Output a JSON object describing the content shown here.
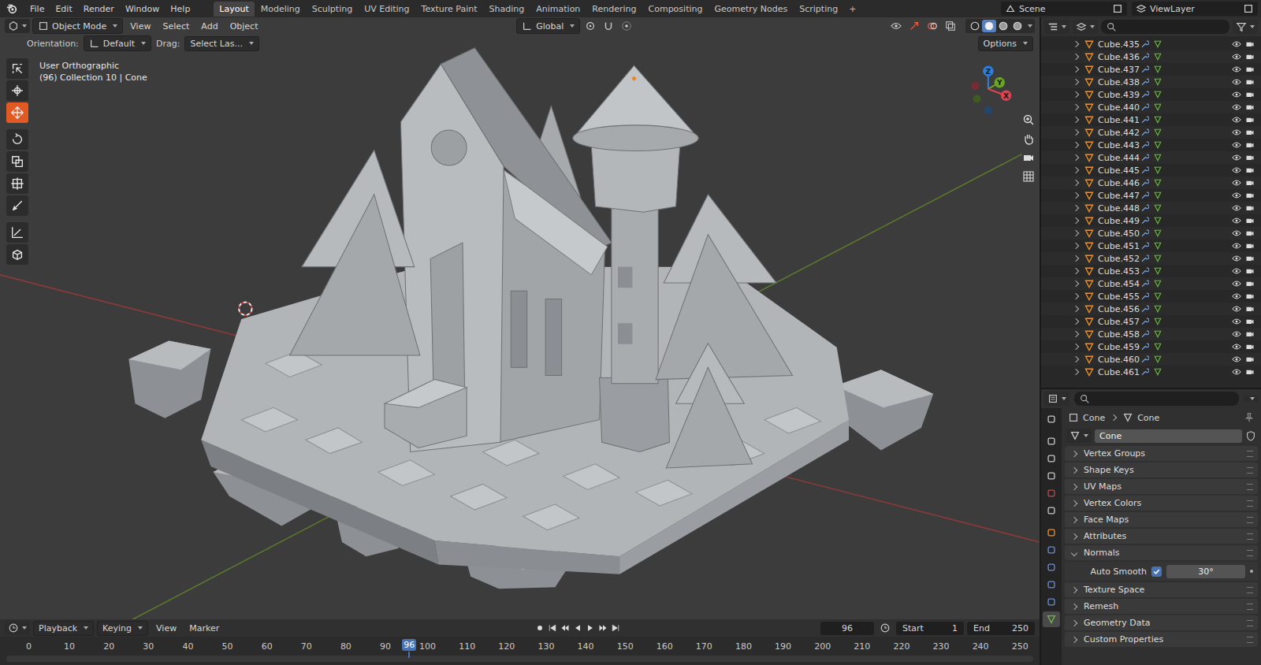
{
  "menubar": {
    "menus": [
      "File",
      "Edit",
      "Render",
      "Window",
      "Help"
    ]
  },
  "workspaces": [
    {
      "label": "Layout",
      "selected": true
    },
    {
      "label": "Modeling",
      "selected": false
    },
    {
      "label": "Sculpting",
      "selected": false
    },
    {
      "label": "UV Editing",
      "selected": false
    },
    {
      "label": "Texture Paint",
      "selected": false
    },
    {
      "label": "Shading",
      "selected": false
    },
    {
      "label": "Animation",
      "selected": false
    },
    {
      "label": "Rendering",
      "selected": false
    },
    {
      "label": "Compositing",
      "selected": false
    },
    {
      "label": "Geometry Nodes",
      "selected": false
    },
    {
      "label": "Scripting",
      "selected": false
    }
  ],
  "add_workspace": "+",
  "scene": {
    "label": "Scene"
  },
  "view_layer": {
    "label": "ViewLayer"
  },
  "viewport": {
    "mode": "Object Mode",
    "menus": [
      "View",
      "Select",
      "Add",
      "Object"
    ],
    "orientation": "Global",
    "shading": [
      {
        "selected": false
      },
      {
        "selected": true
      },
      {
        "selected": false
      },
      {
        "selected": false
      }
    ],
    "tool_settings": {
      "orientation_label": "Orientation:",
      "orientation": "Default",
      "drag_label": "Drag:",
      "drag": "Select Las...",
      "options": "Options"
    },
    "view_name": "User Orthographic",
    "collection_info": "(96) Collection 10 | Cone",
    "tools": [
      {
        "selected": false
      },
      {
        "selected": false
      },
      {
        "selected": true
      },
      {
        "selected": false
      },
      {
        "selected": false
      },
      {
        "selected": false
      },
      {
        "selected": false
      },
      {
        "selected": false
      },
      {
        "selected": false
      }
    ],
    "gizmo_axes": [
      {
        "label": "Z",
        "color": "#2f7fd8"
      },
      {
        "label": "Y",
        "color": "#6aa52a"
      },
      {
        "label": "X",
        "color": "#e0414f"
      }
    ]
  },
  "outliner": {
    "items": [
      {
        "name": "Cube.435",
        "expanded": false,
        "visible": true
      },
      {
        "name": "Cube.436",
        "expanded": false,
        "visible": true
      },
      {
        "name": "Cube.437",
        "expanded": false,
        "visible": true
      },
      {
        "name": "Cube.438",
        "expanded": false,
        "visible": true
      },
      {
        "name": "Cube.439",
        "expanded": false,
        "visible": true
      },
      {
        "name": "Cube.440",
        "expanded": false,
        "visible": true
      },
      {
        "name": "Cube.441",
        "expanded": false,
        "visible": true
      },
      {
        "name": "Cube.442",
        "expanded": false,
        "visible": true
      },
      {
        "name": "Cube.443",
        "expanded": false,
        "visible": true
      },
      {
        "name": "Cube.444",
        "expanded": false,
        "visible": true
      },
      {
        "name": "Cube.445",
        "expanded": false,
        "visible": true
      },
      {
        "name": "Cube.446",
        "expanded": false,
        "visible": true
      },
      {
        "name": "Cube.447",
        "expanded": false,
        "visible": true
      },
      {
        "name": "Cube.448",
        "expanded": false,
        "visible": true
      },
      {
        "name": "Cube.449",
        "expanded": false,
        "visible": true
      },
      {
        "name": "Cube.450",
        "expanded": false,
        "visible": true
      },
      {
        "name": "Cube.451",
        "expanded": false,
        "visible": true
      },
      {
        "name": "Cube.452",
        "expanded": false,
        "visible": true
      },
      {
        "name": "Cube.453",
        "expanded": false,
        "visible": true
      },
      {
        "name": "Cube.454",
        "expanded": false,
        "visible": true
      },
      {
        "name": "Cube.455",
        "expanded": false,
        "visible": true
      },
      {
        "name": "Cube.456",
        "expanded": false,
        "visible": true
      },
      {
        "name": "Cube.457",
        "expanded": false,
        "visible": true
      },
      {
        "name": "Cube.458",
        "expanded": false,
        "visible": true
      },
      {
        "name": "Cube.459",
        "expanded": false,
        "visible": true
      },
      {
        "name": "Cube.460",
        "expanded": false,
        "visible": true
      },
      {
        "name": "Cube.461",
        "expanded": false,
        "visible": true
      }
    ]
  },
  "properties": {
    "tabs": [
      {
        "selected": false
      },
      {
        "selected": false
      },
      {
        "selected": false
      },
      {
        "selected": false
      },
      {
        "selected": false
      },
      {
        "selected": false
      },
      {
        "selected": false
      },
      {
        "selected": false
      },
      {
        "selected": false
      },
      {
        "selected": false
      },
      {
        "selected": false
      },
      {
        "selected": true
      }
    ],
    "breadcrumb": [
      "Cone",
      "Cone"
    ],
    "data_name": "Cone",
    "panels": [
      {
        "label": "Vertex Groups",
        "expanded": false
      },
      {
        "label": "Shape Keys",
        "expanded": false
      },
      {
        "label": "UV Maps",
        "expanded": false
      },
      {
        "label": "Vertex Colors",
        "expanded": false
      },
      {
        "label": "Face Maps",
        "expanded": false
      },
      {
        "label": "Attributes",
        "expanded": false
      },
      {
        "label": "Normals",
        "expanded": true
      },
      {
        "label": "Texture Space",
        "expanded": false
      },
      {
        "label": "Remesh",
        "expanded": false
      },
      {
        "label": "Geometry Data",
        "expanded": false
      },
      {
        "label": "Custom Properties",
        "expanded": false
      }
    ],
    "normals": {
      "auto_smooth_label": "Auto Smooth",
      "auto_smooth": true,
      "angle": "30°"
    }
  },
  "timeline": {
    "menus": [
      {
        "label": "Playback",
        "dropdown": true
      },
      {
        "label": "Keying",
        "dropdown": true
      },
      {
        "label": "View",
        "dropdown": false
      },
      {
        "label": "Marker",
        "dropdown": false
      }
    ],
    "current_frame": "96",
    "start_label": "Start",
    "start": "1",
    "end_label": "End",
    "end": "250",
    "ticks": [
      "0",
      "10",
      "20",
      "30",
      "40",
      "50",
      "60",
      "70",
      "80",
      "90",
      "100",
      "110",
      "120",
      "130",
      "140",
      "150",
      "160",
      "170",
      "180",
      "190",
      "200",
      "210",
      "220",
      "230",
      "240",
      "250"
    ],
    "playhead": "96",
    "playhead_level": 0.384
  }
}
